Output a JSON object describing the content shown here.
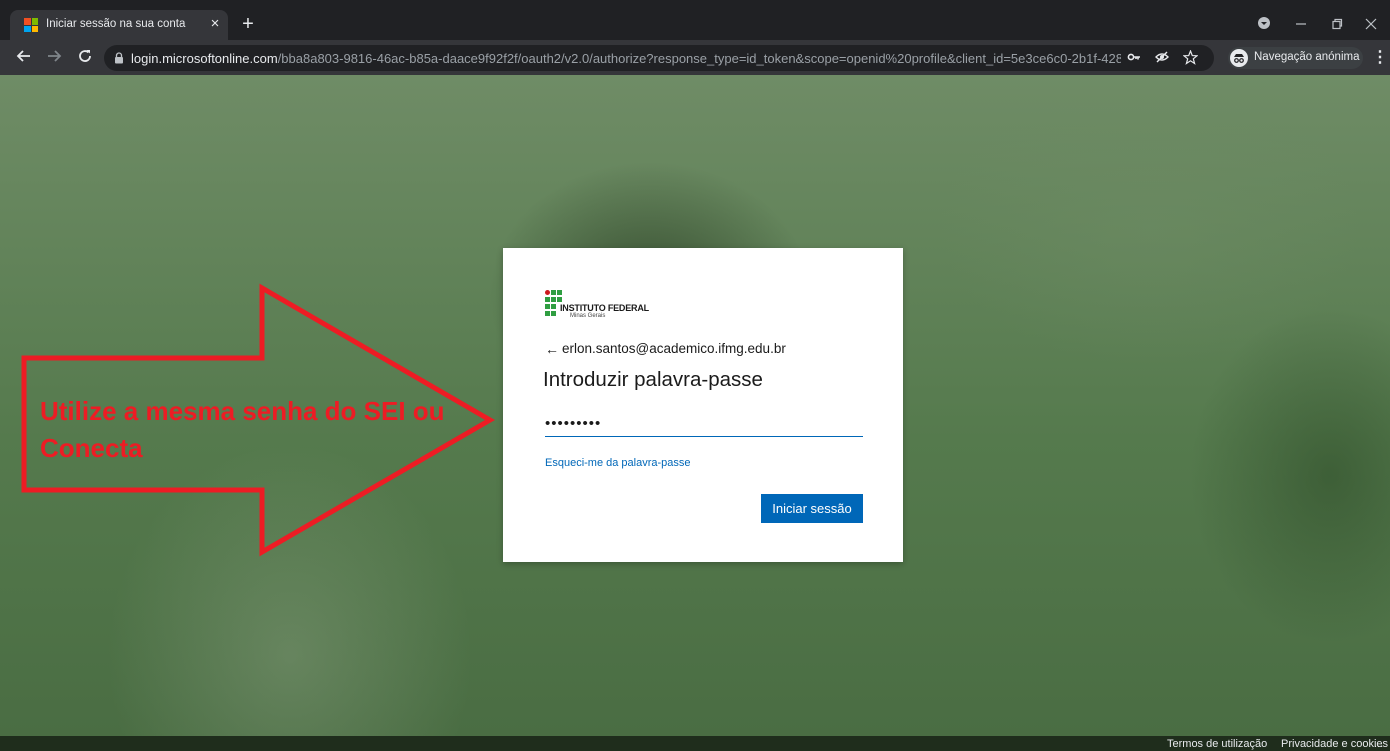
{
  "browser": {
    "tab": {
      "title": "Iniciar sessão na sua conta",
      "close": "×"
    },
    "new_tab": "+",
    "address_bar": {
      "host": "login.microsoftonline.com",
      "path": "/bba8a803-9816-46ac-b85a-daace9f92f2f/oauth2/v2.0/authorize?response_type=id_token&scope=openid%20profile&client_id=5e3ce6c0-2b1f-4285..."
    },
    "incognito_label": "Navegação anónima",
    "colors": {
      "frame": "#202124",
      "toolbar": "#35363a"
    }
  },
  "login": {
    "org_name": "INSTITUTO FEDERAL",
    "org_subname": "Minas Gerais",
    "back_arrow": "←",
    "identity": "erlon.santos@academico.ifmg.edu.br",
    "title": "Introduzir palavra-passe",
    "password_masked": "•••••••••",
    "forgot_link": "Esqueci-me da palavra-passe",
    "signin_button": "Iniciar sessão",
    "colors": {
      "accent": "#0067b8"
    }
  },
  "annotation": {
    "text": "Utilize a mesma senha do SEI ou Conecta",
    "color": "#ed1c24"
  },
  "footer": {
    "terms": "Termos de utilização",
    "privacy": "Privacidade e cookies",
    "more": "..."
  }
}
